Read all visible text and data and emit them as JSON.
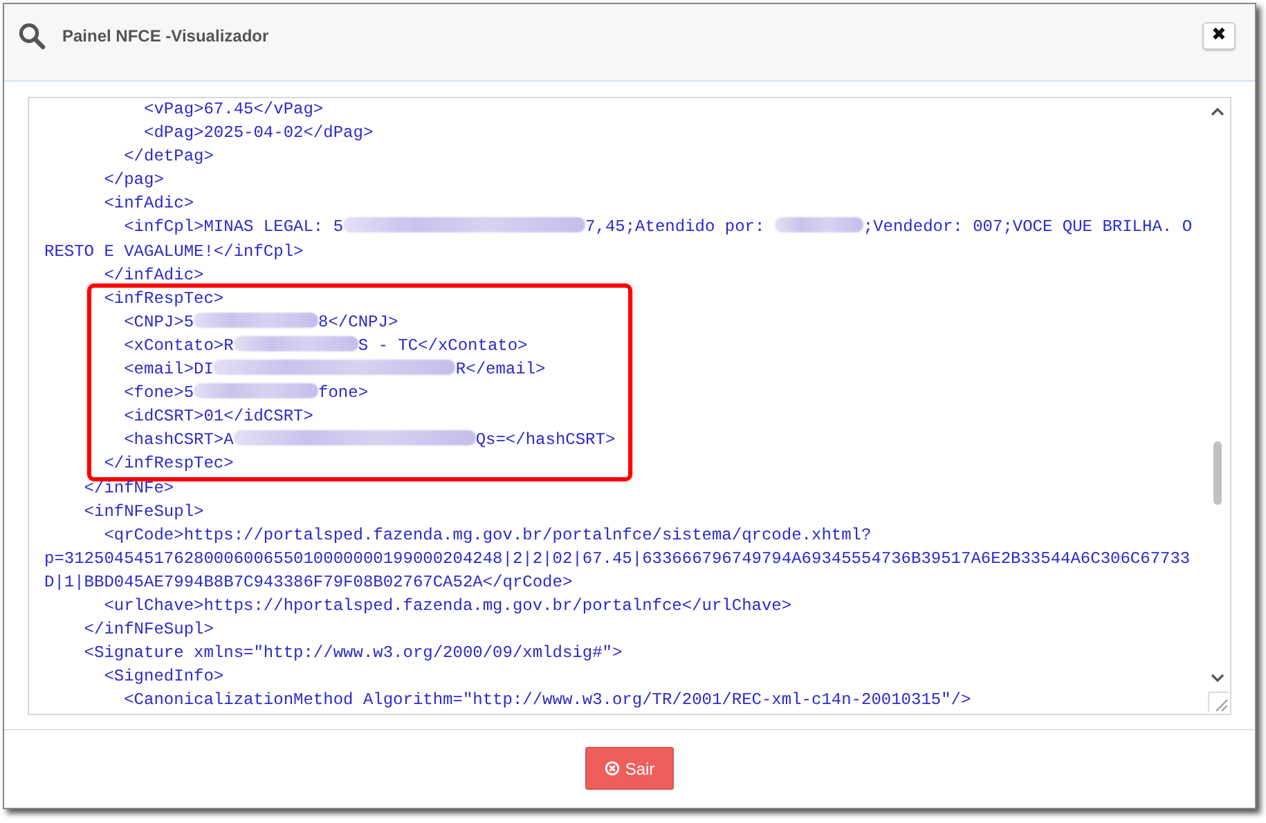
{
  "dialog": {
    "title": "Painel NFCE -Visualizador",
    "close_label": "✖"
  },
  "xml_lines": [
    {
      "kind": "line",
      "segments": [
        {
          "kind": "text",
          "text": "          <vPag>67.45</vPag>"
        }
      ]
    },
    {
      "kind": "line",
      "segments": [
        {
          "kind": "text",
          "text": "          <dPag>2025-04-02</dPag>"
        }
      ]
    },
    {
      "kind": "line",
      "segments": [
        {
          "kind": "text",
          "text": "        </detPag>"
        }
      ]
    },
    {
      "kind": "line",
      "segments": [
        {
          "kind": "text",
          "text": "      </pag>"
        }
      ]
    },
    {
      "kind": "line",
      "segments": [
        {
          "kind": "text",
          "text": "      <infAdic>"
        }
      ]
    },
    {
      "kind": "line",
      "segments": [
        {
          "kind": "text",
          "text": "        <infCpl>MINAS LEGAL: 5"
        },
        {
          "kind": "redacted_wide"
        },
        {
          "kind": "text",
          "text": "7,45;Atendido por: "
        },
        {
          "kind": "redacted_short"
        },
        {
          "kind": "text",
          "text": ";Vendedor: 007;VOCE QUE BRILHA. O"
        }
      ]
    },
    {
      "kind": "line",
      "segments": [
        {
          "kind": "text",
          "text": "RESTO E VAGALUME!</infCpl>"
        }
      ]
    },
    {
      "kind": "line",
      "segments": [
        {
          "kind": "text",
          "text": "      </infAdic>"
        }
      ]
    },
    {
      "kind": "highlight",
      "lines": [
        {
          "kind": "line",
          "segments": [
            {
              "kind": "text",
              "text": "      <infRespTec>"
            }
          ]
        },
        {
          "kind": "line",
          "segments": [
            {
              "kind": "text",
              "text": "        <CNPJ>5"
            },
            {
              "kind": "redacted"
            },
            {
              "kind": "text",
              "text": "8</CNPJ>"
            }
          ]
        },
        {
          "kind": "line",
          "segments": [
            {
              "kind": "text",
              "text": "        <xContato>R"
            },
            {
              "kind": "redacted"
            },
            {
              "kind": "text",
              "text": "S - TC</xContato>"
            }
          ]
        },
        {
          "kind": "line",
          "segments": [
            {
              "kind": "text",
              "text": "        <email>DI"
            },
            {
              "kind": "redacted_wide"
            },
            {
              "kind": "text",
              "text": "R</email>"
            }
          ]
        },
        {
          "kind": "line",
          "segments": [
            {
              "kind": "text",
              "text": "        <fone>5"
            },
            {
              "kind": "redacted"
            },
            {
              "kind": "text",
              "text": "fone>"
            }
          ]
        },
        {
          "kind": "line",
          "segments": [
            {
              "kind": "text",
              "text": "        <idCSRT>01</idCSRT>"
            }
          ]
        },
        {
          "kind": "line",
          "segments": [
            {
              "kind": "text",
              "text": "        <hashCSRT>A"
            },
            {
              "kind": "redacted_wide"
            },
            {
              "kind": "text",
              "text": "Qs=</hashCSRT>"
            }
          ]
        },
        {
          "kind": "line",
          "segments": [
            {
              "kind": "text",
              "text": "      </infRespTec>"
            }
          ]
        }
      ]
    },
    {
      "kind": "line",
      "segments": [
        {
          "kind": "text",
          "text": "    </infNFe>"
        }
      ]
    },
    {
      "kind": "line",
      "segments": [
        {
          "kind": "text",
          "text": "    <infNFeSupl>"
        }
      ]
    },
    {
      "kind": "line",
      "segments": [
        {
          "kind": "text",
          "text": "      <qrCode>https://portalsped.fazenda.mg.gov.br/portalnfce/sistema/qrcode.xhtml?"
        }
      ]
    },
    {
      "kind": "line",
      "segments": [
        {
          "kind": "text",
          "text": "p=31250454517628000600655010000000199000204248|2|2|02|67.45|633666796749794A69345554736B39517A6E2B33544A6C306C67733"
        }
      ]
    },
    {
      "kind": "line",
      "segments": [
        {
          "kind": "text",
          "text": "D|1|BBD045AE7994B8B7C943386F79F08B02767CA52A</qrCode>"
        }
      ]
    },
    {
      "kind": "line",
      "segments": [
        {
          "kind": "text",
          "text": "      <urlChave>https://hportalsped.fazenda.mg.gov.br/portalnfce</urlChave>"
        }
      ]
    },
    {
      "kind": "line",
      "segments": [
        {
          "kind": "text",
          "text": "    </infNFeSupl>"
        }
      ]
    },
    {
      "kind": "line",
      "segments": [
        {
          "kind": "text",
          "text": "    <Signature xmlns=\"http://www.w3.org/2000/09/xmldsig#\">"
        }
      ]
    },
    {
      "kind": "line",
      "segments": [
        {
          "kind": "text",
          "text": "      <SignedInfo>"
        }
      ]
    },
    {
      "kind": "line",
      "segments": [
        {
          "kind": "text",
          "text": "        <CanonicalizationMethod Algorithm=\"http://www.w3.org/TR/2001/REC-xml-c14n-20010315\"/>"
        }
      ]
    }
  ],
  "footer": {
    "button": "Sair"
  }
}
